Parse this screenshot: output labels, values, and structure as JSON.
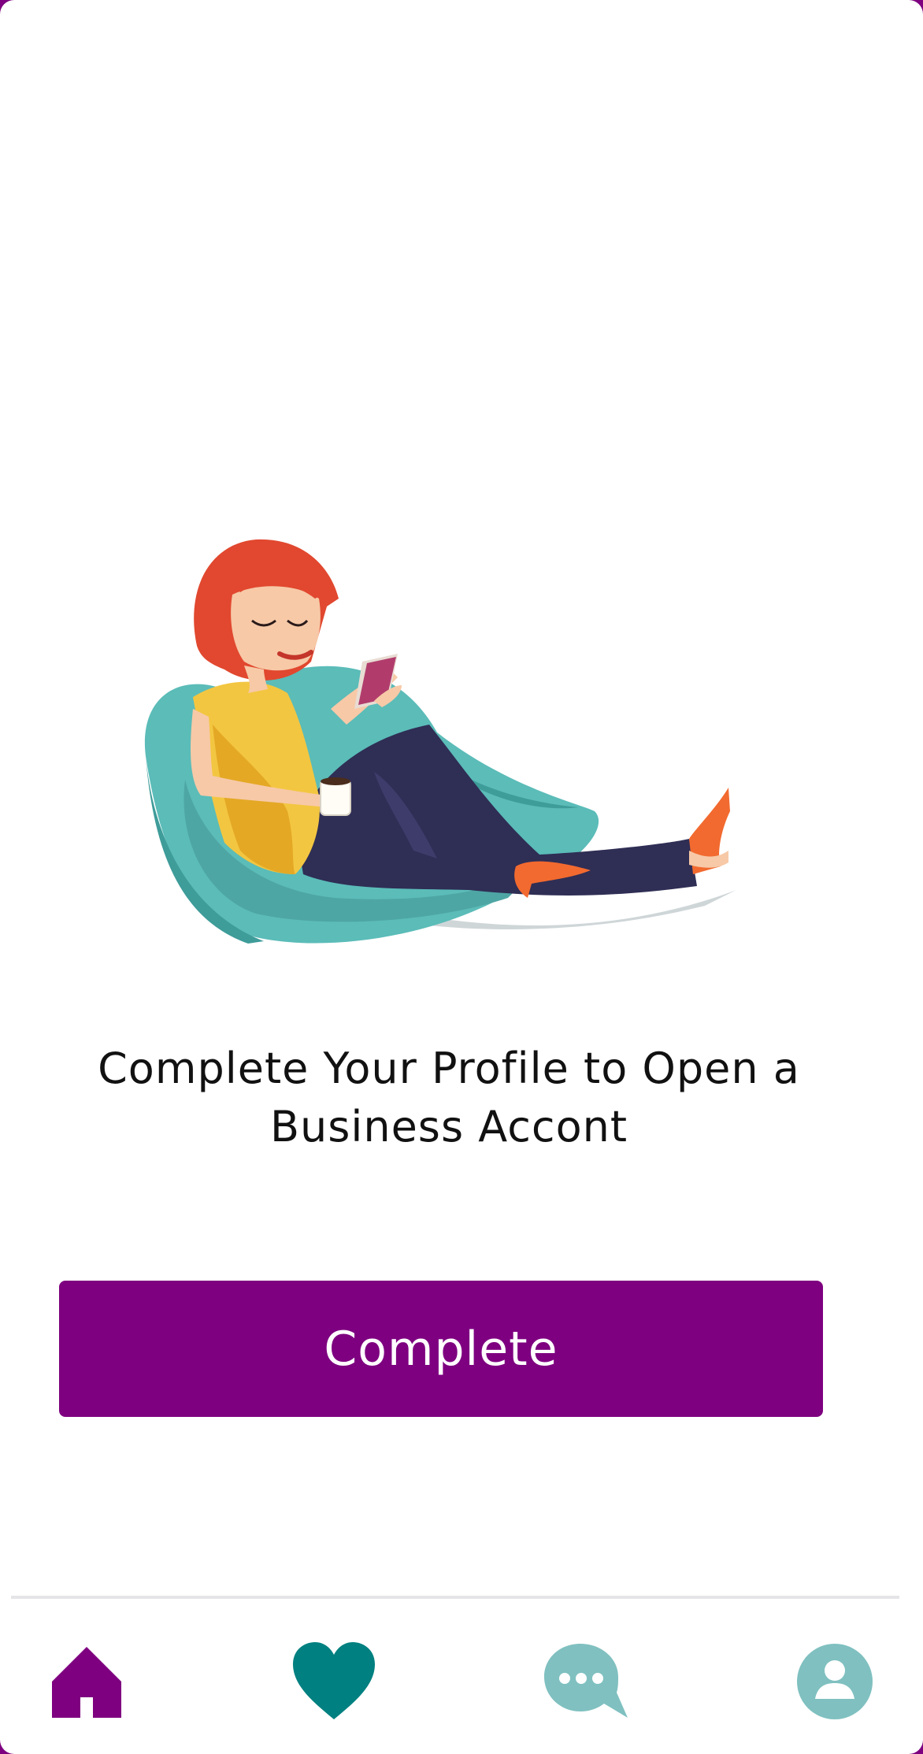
{
  "onboarding": {
    "headline": "Complete Your Profile to Open a Business Accont",
    "cta_label": "Complete"
  },
  "tabbar": {
    "tabs": [
      {
        "icon": "home-icon",
        "color": "#7e0080",
        "active": true
      },
      {
        "icon": "heart-icon",
        "color": "#008080",
        "active": false
      },
      {
        "icon": "chat-bubble-icon",
        "color": "#80c0c0",
        "active": false
      },
      {
        "icon": "profile-icon",
        "color": "#80c0c0",
        "active": false
      }
    ]
  },
  "colors": {
    "brand": "#7e0080",
    "accent_teal": "#008080",
    "muted_teal": "#80c0c0"
  }
}
